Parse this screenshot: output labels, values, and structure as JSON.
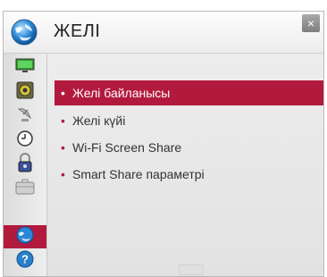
{
  "header": {
    "title": "ЖЕЛІ",
    "icon": "network-globe-icon",
    "close_label": "×"
  },
  "sidebar": {
    "items": [
      {
        "icon": "picture-monitor-icon"
      },
      {
        "icon": "sound-speaker-icon"
      },
      {
        "icon": "channel-satellite-icon"
      },
      {
        "icon": "time-clock-icon"
      },
      {
        "icon": "lock-icon"
      },
      {
        "icon": "option-suitcase-icon"
      },
      {
        "icon": "network-globe-icon",
        "active": true
      },
      {
        "icon": "support-question-icon"
      }
    ]
  },
  "menu": {
    "items": [
      {
        "label": "Желі байланысы",
        "selected": true
      },
      {
        "label": "Желі күйі"
      },
      {
        "label": "Wi-Fi Screen Share"
      },
      {
        "label": "Smart Share параметрі"
      }
    ],
    "bullet": "•"
  },
  "colors": {
    "accent": "#b21a3d",
    "panel_bg": "#e8e8e8"
  }
}
